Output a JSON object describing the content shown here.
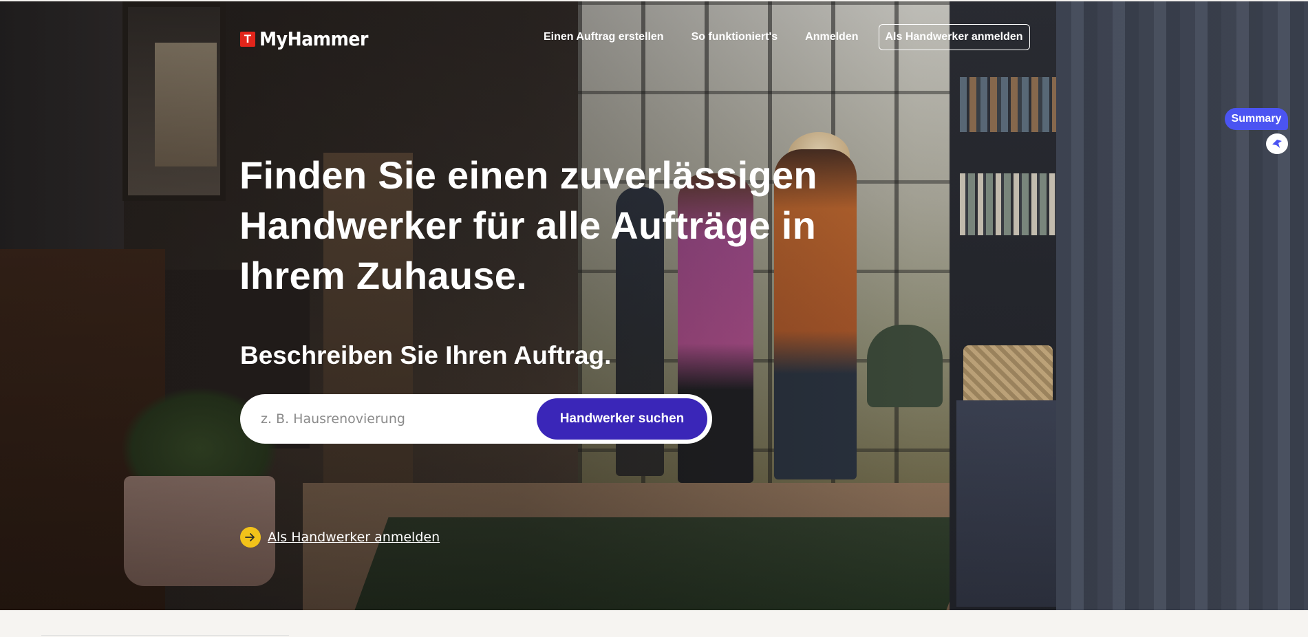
{
  "brand": {
    "logo_mark": "T",
    "name": "MyHammer",
    "accent": "#e2251b"
  },
  "nav": {
    "links": [
      "Einen Auftrag erstellen",
      "So funktioniert's",
      "Anmelden"
    ],
    "pro_login_button": "Als Handwerker anmelden"
  },
  "hero": {
    "headline": "Finden Sie einen zuverlässigen Handwerker für alle Aufträge in Ihrem Zuhause.",
    "subhead": "Beschreiben Sie Ihren Auftrag.",
    "search": {
      "placeholder": "z. B. Hausrenovierung",
      "value": "",
      "button": "Handwerker suchen",
      "button_color": "#3a26b8"
    },
    "pro_link": {
      "icon": "arrow-right-icon",
      "label": "Als Handwerker anmelden",
      "icon_color": "#f2c21a"
    }
  },
  "widget": {
    "summary_label": "Summary",
    "summary_color": "#4b54f2",
    "icon": "assistant-icon"
  }
}
